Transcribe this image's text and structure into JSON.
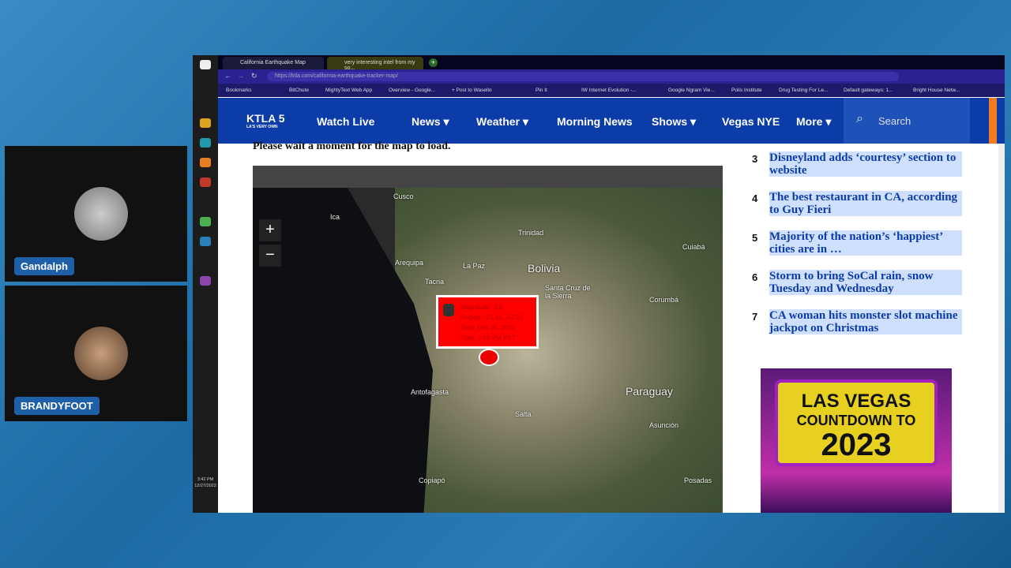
{
  "participants": [
    {
      "name": "Gandalph"
    },
    {
      "name": "BRANDYFOOT"
    }
  ],
  "taskbar": {
    "time": "3:42 PM",
    "date": "12/27/2022"
  },
  "browser": {
    "tabs": [
      {
        "label": "California Earthquake Map",
        "active": true
      },
      {
        "label": "very interesting intel from my so..."
      }
    ],
    "url": "https://ktla.com/california-earthquake-tracker-map/",
    "bookmarks": [
      "Bookmarks",
      "BitChute",
      "MightyText Web App",
      "Overview - Google...",
      "+ Post to Wasello",
      "Pin It",
      "IW Internet Evolution -...",
      "Google Ngram Vie...",
      "Polis Institute",
      "Drug Testing For Le...",
      "Default gateways: 1...",
      "Bright House Netw..."
    ]
  },
  "site": {
    "logo": "KTLA 5",
    "logo_sub": "LA'S VERY OWN",
    "nav": [
      "Watch Live",
      "News ▾",
      "Weather ▾",
      "Morning News",
      "Shows ▾",
      "Vegas NYE",
      "More ▾"
    ],
    "search_placeholder": "Search"
  },
  "main": {
    "wait_text": "Please wait a moment for the map to load.",
    "map": {
      "zoom_in": "+",
      "zoom_out": "−",
      "labels": [
        "Cusco",
        "Ica",
        "Trinidad",
        "Arequipa",
        "La Paz",
        "Bolivia",
        "Cuiabá",
        "Tacna",
        "Santa Cruz de la Sierra",
        "Corumbá",
        "Antofagasta",
        "Paraguay",
        "Salta",
        "Asunción",
        "Copiapó",
        "Posadas"
      ],
      "popup": {
        "magnitude": "Magnitude: 3.0",
        "region": "Region: -21.41, -67.21",
        "date": "Date: Dec 26, 2022",
        "time": "Time: 3:55 PM PST"
      }
    }
  },
  "trending": [
    {
      "n": "3",
      "title": "Disneyland adds ‘courtesy’ section to website"
    },
    {
      "n": "4",
      "title": "The best restaurant in CA, according to Guy Fieri"
    },
    {
      "n": "5",
      "title": "Majority of the nation’s ‘happiest’ cities are in …"
    },
    {
      "n": "6",
      "title": "Storm to bring SoCal rain, snow Tuesday and Wednesday"
    },
    {
      "n": "7",
      "title": "CA woman hits monster slot machine jackpot on Christmas"
    }
  ],
  "ad": {
    "line1": "LAS VEGAS",
    "line2": "COUNTDOWN TO",
    "line3": "2023"
  }
}
